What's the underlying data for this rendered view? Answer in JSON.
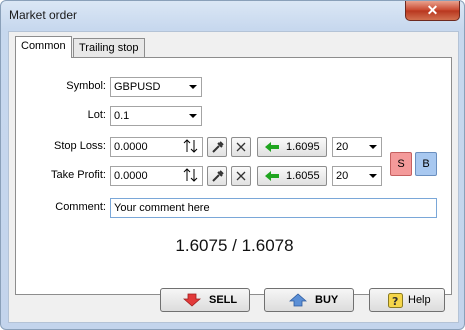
{
  "window": {
    "title": "Market order",
    "close_glyph": "✕"
  },
  "tabs": [
    {
      "label": "Common",
      "active": true
    },
    {
      "label": "Trailing stop",
      "active": false
    }
  ],
  "form": {
    "symbol_label": "Symbol:",
    "symbol_value": "GBPUSD",
    "lot_label": "Lot:",
    "lot_value": "0.1",
    "stoploss_label": "Stop Loss:",
    "stoploss_value": "0.0000",
    "stoploss_price": "1.6095",
    "stoploss_points": "20",
    "takeprofit_label": "Take Profit:",
    "takeprofit_value": "0.0000",
    "takeprofit_price": "1.6055",
    "takeprofit_points": "20",
    "comment_label": "Comment:",
    "comment_value": "Your comment here",
    "sell_side_label": "S",
    "buy_side_label": "B"
  },
  "quote": "1.6075 / 1.6078",
  "buttons": {
    "sell": "SELL",
    "buy": "BUY",
    "help": "Help"
  },
  "colors": {
    "sell_toggle": "#f49a9a",
    "buy_toggle": "#a8c8f0",
    "arrow_green": "#1fa51f"
  }
}
